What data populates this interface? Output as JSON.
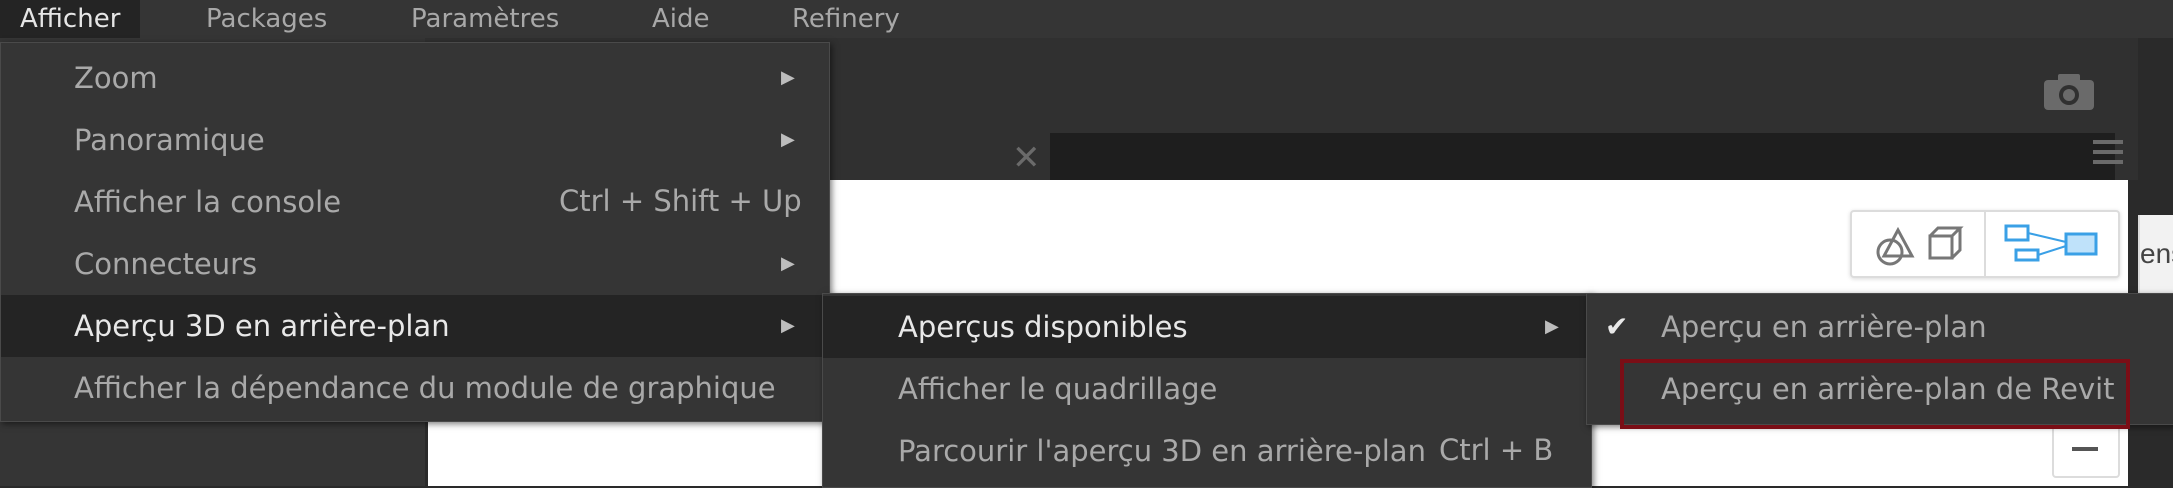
{
  "menubar": {
    "items": [
      "Afficher",
      "Packages",
      "Paramètres",
      "Aide",
      "Refinery"
    ]
  },
  "background": {
    "side_text": "ens",
    "close_glyph": "✕"
  },
  "view_menu": {
    "items": [
      {
        "label": "Zoom",
        "shortcut": "",
        "submenu": true
      },
      {
        "label": "Panoramique",
        "shortcut": "",
        "submenu": true
      },
      {
        "label": "Afficher la console",
        "shortcut": "Ctrl + Shift + Up",
        "submenu": false
      },
      {
        "label": "Connecteurs",
        "shortcut": "",
        "submenu": true
      },
      {
        "label": "Aperçu 3D en arrière-plan",
        "shortcut": "",
        "submenu": true
      },
      {
        "label": "Afficher la dépendance du module de graphique",
        "shortcut": "",
        "submenu": false
      }
    ],
    "arrow_glyph": "▶"
  },
  "preview_menu": {
    "items": [
      {
        "label": "Aperçus disponibles",
        "shortcut": "",
        "submenu": true
      },
      {
        "label": "Afficher le quadrillage",
        "shortcut": "",
        "submenu": false
      },
      {
        "label": "Parcourir l'aperçu 3D en arrière-plan",
        "shortcut": "Ctrl + B",
        "submenu": false
      }
    ]
  },
  "available_menu": {
    "items": [
      {
        "label": "Aperçu en arrière-plan",
        "checked": true
      },
      {
        "label": "Aperçu en arrière-plan de Revit",
        "checked": false
      }
    ],
    "check_glyph": "✔"
  },
  "colors": {
    "highlight_box": "#7a0e16",
    "accent_blue": "#3aa0e6"
  }
}
